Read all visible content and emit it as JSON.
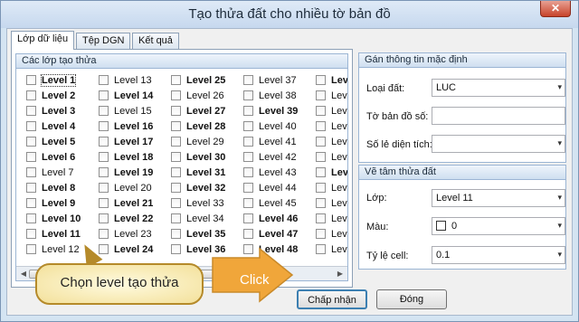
{
  "window": {
    "title": "Tạo thửa đất cho nhiều tờ bản đồ",
    "close_glyph": "✕"
  },
  "tabs": [
    {
      "label": "Lớp dữ liệu"
    },
    {
      "label": "Tệp DGN"
    },
    {
      "label": "Kết quả"
    }
  ],
  "layers_group": {
    "title": "Các lớp tạo thửa",
    "columns": [
      [
        {
          "label": "Level 1",
          "bold": true
        },
        {
          "label": "Level 2",
          "bold": true
        },
        {
          "label": "Level 3",
          "bold": true
        },
        {
          "label": "Level 4",
          "bold": true
        },
        {
          "label": "Level 5",
          "bold": true
        },
        {
          "label": "Level 6",
          "bold": true
        },
        {
          "label": "Level 7",
          "bold": false
        },
        {
          "label": "Level 8",
          "bold": true
        },
        {
          "label": "Level 9",
          "bold": true
        },
        {
          "label": "Level 10",
          "bold": true
        },
        {
          "label": "Level 11",
          "bold": true
        },
        {
          "label": "Level 12",
          "bold": false
        }
      ],
      [
        {
          "label": "Level 13",
          "bold": false
        },
        {
          "label": "Level 14",
          "bold": true
        },
        {
          "label": "Level 15",
          "bold": false
        },
        {
          "label": "Level 16",
          "bold": true
        },
        {
          "label": "Level 17",
          "bold": true
        },
        {
          "label": "Level 18",
          "bold": true
        },
        {
          "label": "Level 19",
          "bold": true
        },
        {
          "label": "Level 20",
          "bold": false
        },
        {
          "label": "Level 21",
          "bold": true
        },
        {
          "label": "Level 22",
          "bold": true
        },
        {
          "label": "Level 23",
          "bold": false
        },
        {
          "label": "Level 24",
          "bold": true
        }
      ],
      [
        {
          "label": "Level 25",
          "bold": true
        },
        {
          "label": "Level 26",
          "bold": false
        },
        {
          "label": "Level 27",
          "bold": true
        },
        {
          "label": "Level 28",
          "bold": true
        },
        {
          "label": "Level 29",
          "bold": false
        },
        {
          "label": "Level 30",
          "bold": true
        },
        {
          "label": "Level 31",
          "bold": true
        },
        {
          "label": "Level 32",
          "bold": true
        },
        {
          "label": "Level 33",
          "bold": false
        },
        {
          "label": "Level 34",
          "bold": false
        },
        {
          "label": "Level 35",
          "bold": true
        },
        {
          "label": "Level 36",
          "bold": true
        }
      ],
      [
        {
          "label": "Level 37",
          "bold": false
        },
        {
          "label": "Level 38",
          "bold": false
        },
        {
          "label": "Level 39",
          "bold": true
        },
        {
          "label": "Level 40",
          "bold": false
        },
        {
          "label": "Level 41",
          "bold": false
        },
        {
          "label": "Level 42",
          "bold": false
        },
        {
          "label": "Level 43",
          "bold": false
        },
        {
          "label": "Level 44",
          "bold": false
        },
        {
          "label": "Level 45",
          "bold": false
        },
        {
          "label": "Level 46",
          "bold": true
        },
        {
          "label": "Level 47",
          "bold": true
        },
        {
          "label": "Level 48",
          "bold": true
        }
      ],
      [
        {
          "label": "Level",
          "bold": true
        },
        {
          "label": "Level",
          "bold": false
        },
        {
          "label": "Level",
          "bold": false
        },
        {
          "label": "Level",
          "bold": false
        },
        {
          "label": "Level",
          "bold": false
        },
        {
          "label": "Level",
          "bold": false
        },
        {
          "label": "Level",
          "bold": true
        },
        {
          "label": "Level",
          "bold": false
        },
        {
          "label": "Level",
          "bold": false
        },
        {
          "label": "Level",
          "bold": false
        },
        {
          "label": "Level",
          "bold": false
        },
        {
          "label": "Level",
          "bold": false
        }
      ]
    ],
    "focused_item": "Level 1"
  },
  "defaults_group": {
    "title": "Gán thông tin mặc định",
    "land_type_label": "Loại đất:",
    "land_type_value": "LUC",
    "map_sheet_label": "Tờ bản đồ số:",
    "map_sheet_value": "",
    "area_decimals_label": "Số lẻ diện tích:",
    "area_decimals_value": ""
  },
  "centroid_group": {
    "title": "Vẽ tâm thửa đất",
    "layer_label": "Lớp:",
    "layer_value": "Level 11",
    "color_label": "Màu:",
    "color_value": "0",
    "cell_scale_label": "Tỷ lệ cell:",
    "cell_scale_value": "0.1"
  },
  "buttons": {
    "accept": "Chấp nhận",
    "close": "Đóng"
  },
  "annotations": {
    "callout": "Chọn level tạo thửa",
    "click": "Click"
  },
  "colors": {
    "arrow": "#f0a63a",
    "title_bar": "#c6d8ee",
    "group_header": "#cfdff0"
  }
}
